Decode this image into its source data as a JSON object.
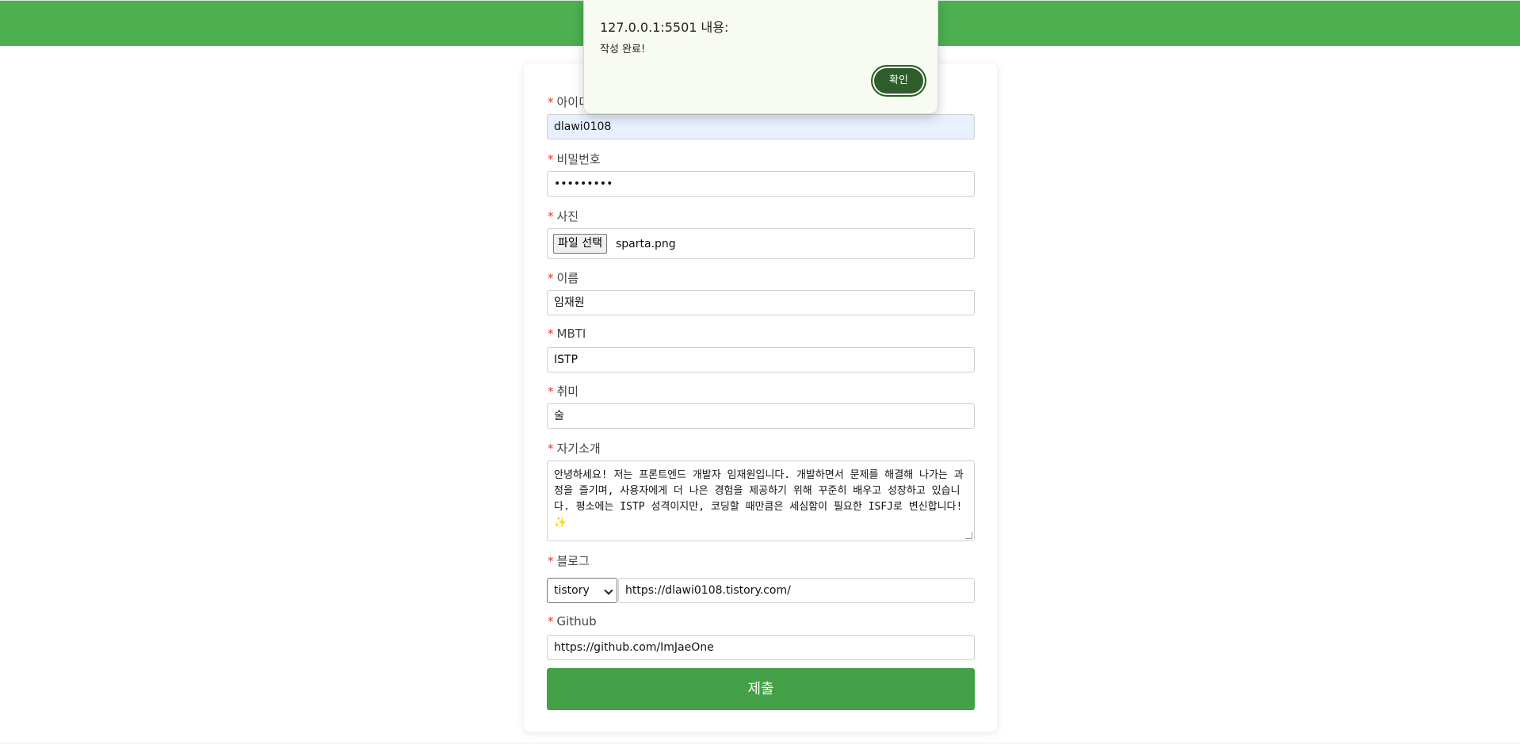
{
  "dialog": {
    "title": "127.0.0.1:5501 내용:",
    "message": "작성 완료!",
    "ok_label": "확인"
  },
  "form": {
    "id": {
      "label": "아이디",
      "value": "dlawi0108"
    },
    "password": {
      "label": "비밀번호",
      "value": "•••••••••"
    },
    "photo": {
      "label": "사진",
      "button_label": "파일 선택",
      "file_name": "sparta.png"
    },
    "name": {
      "label": "이름",
      "value": "임재원"
    },
    "mbti": {
      "label": "MBTI",
      "value": "ISTP"
    },
    "hobby": {
      "label": "취미",
      "value": "술"
    },
    "intro": {
      "label": "자기소개",
      "value": "안녕하세요! 저는 프론트엔드 개발자 임재원입니다. 개발하면서 문제를 해결해 나가는 과정을 즐기며, 사용자에게 더 나은 경험을 제공하기 위해 꾸준히 배우고 성장하고 있습니다. 평소에는 ISTP 성격이지만, 코딩할 때만큼은 세심함이 필요한 ISFJ로 변신합니다!✨"
    },
    "blog": {
      "label": "블로그",
      "platform": "tistory",
      "url": "https://dlawi0108.tistory.com/"
    },
    "github": {
      "label": "Github",
      "value": "https://github.com/ImJaeOne"
    },
    "submit_label": "제출",
    "required_mark": "*"
  },
  "colors": {
    "header": "#4caf50",
    "submit": "#43a047",
    "required": "#e53935",
    "dialog_button": "#2e5d2b"
  }
}
